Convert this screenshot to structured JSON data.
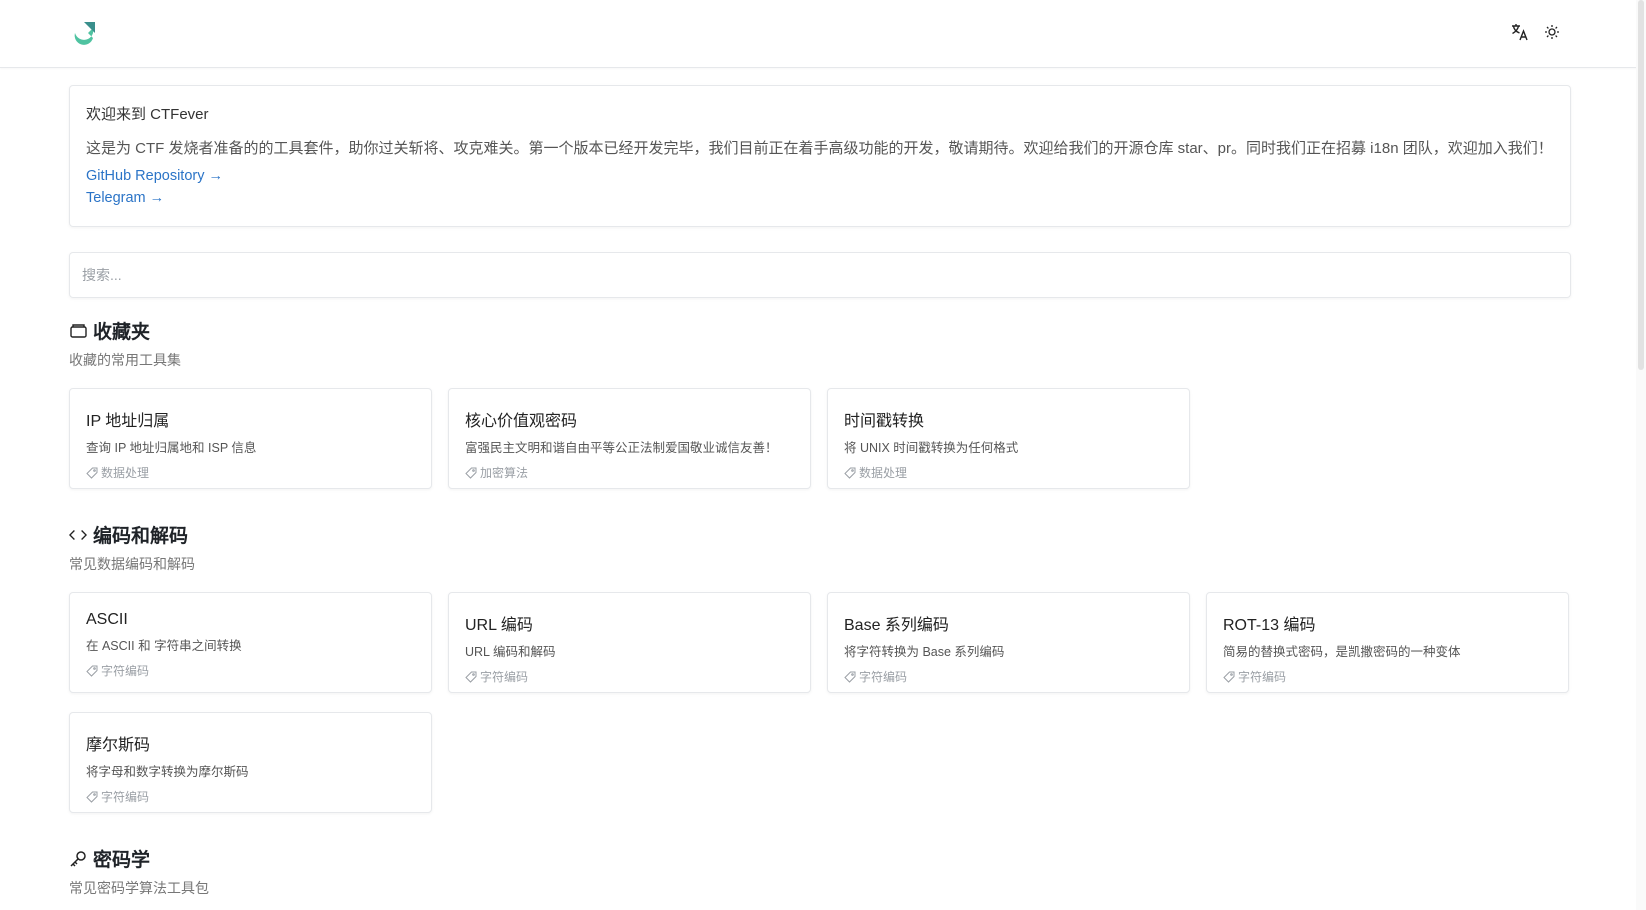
{
  "header": {
    "logo_icon": "ctfever-logo-icon",
    "translate_icon": "translate-icon",
    "theme_icon": "sun-icon"
  },
  "welcome": {
    "title": "欢迎来到 CTFever",
    "text": "这是为 CTF 发烧者准备的的工具套件，助你过关斩将、攻克难关。第一个版本已经开发完毕，我们目前正在着手高级功能的开发，敬请期待。欢迎给我们的开源仓库 star、pr。同时我们正在招募 i18n 团队，欢迎加入我们！",
    "links": [
      "GitHub Repository →",
      "Telegram →"
    ]
  },
  "search": {
    "placeholder": "搜索..."
  },
  "sections": [
    {
      "icon": "folder-icon",
      "title": "收藏夹",
      "desc": "收藏的常用工具集",
      "cards": [
        {
          "title": "IP 地址归属",
          "desc": "查询 IP 地址归属地和 ISP 信息",
          "tag": "数据处理"
        },
        {
          "title": "核心价值观密码",
          "desc": "富强民主文明和谐自由平等公正法制爱国敬业诚信友善！",
          "tag": "加密算法"
        },
        {
          "title": "时间戳转换",
          "desc": "将 UNIX 时间戳转换为任何格式",
          "tag": "数据处理"
        }
      ]
    },
    {
      "icon": "code-brackets-icon",
      "title": "编码和解码",
      "desc": "常见数据编码和解码",
      "cards": [
        {
          "title": "ASCII",
          "desc": "在 ASCII 和 字符串之间转换",
          "tag": "字符编码"
        },
        {
          "title": "URL 编码",
          "desc": "URL 编码和解码",
          "tag": "字符编码"
        },
        {
          "title": "Base 系列编码",
          "desc": "将字符转换为 Base 系列编码",
          "tag": "字符编码"
        },
        {
          "title": "ROT-13 编码",
          "desc": "简易的替换式密码，是凯撒密码的一种变体",
          "tag": "字符编码"
        },
        {
          "title": "摩尔斯码",
          "desc": "将字母和数字转换为摩尔斯码",
          "tag": "字符编码"
        }
      ]
    },
    {
      "icon": "key-icon",
      "title": "密码学",
      "desc": "常见密码学算法工具包",
      "cards": []
    }
  ]
}
